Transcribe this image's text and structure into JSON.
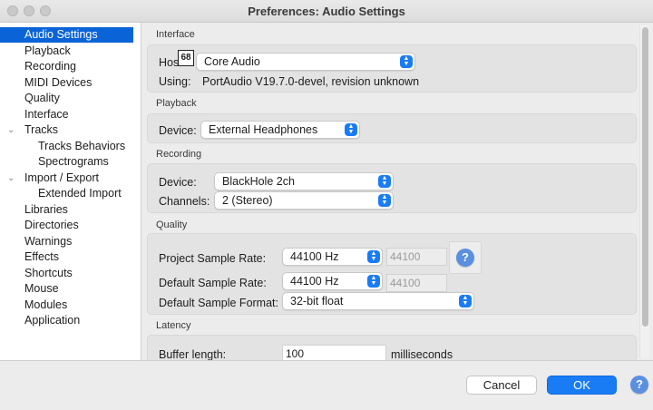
{
  "window": {
    "title": "Preferences: Audio Settings"
  },
  "sidebar": {
    "items": [
      {
        "label": "Audio Settings",
        "selected": true,
        "level": 1
      },
      {
        "label": "Playback",
        "level": 1
      },
      {
        "label": "Recording",
        "level": 1
      },
      {
        "label": "MIDI Devices",
        "level": 1
      },
      {
        "label": "Quality",
        "level": 1
      },
      {
        "label": "Interface",
        "level": 1
      },
      {
        "label": "Tracks",
        "level": 1,
        "expanded": true
      },
      {
        "label": "Tracks Behaviors",
        "level": 2
      },
      {
        "label": "Spectrograms",
        "level": 2
      },
      {
        "label": "Import / Export",
        "level": 1,
        "expanded": true
      },
      {
        "label": "Extended Import",
        "level": 2
      },
      {
        "label": "Libraries",
        "level": 1
      },
      {
        "label": "Directories",
        "level": 1
      },
      {
        "label": "Warnings",
        "level": 1
      },
      {
        "label": "Effects",
        "level": 1
      },
      {
        "label": "Shortcuts",
        "level": 1
      },
      {
        "label": "Mouse",
        "level": 1
      },
      {
        "label": "Modules",
        "level": 1
      },
      {
        "label": "Application",
        "level": 1
      }
    ]
  },
  "interface": {
    "section": "Interface",
    "host_label": "Hos",
    "host_value": "Core Audio",
    "badge": "68",
    "using_label": "Using:",
    "using_value": "PortAudio V19.7.0-devel, revision unknown"
  },
  "playback": {
    "section": "Playback",
    "device_label": "Device:",
    "device_value": "External Headphones"
  },
  "recording": {
    "section": "Recording",
    "device_label": "Device:",
    "device_value": "BlackHole 2ch",
    "channels_label": "Channels:",
    "channels_value": "2 (Stereo)"
  },
  "quality": {
    "section": "Quality",
    "project_rate_label": "Project Sample Rate:",
    "project_rate_value": "44100 Hz",
    "project_rate_field": "44100",
    "default_rate_label": "Default Sample Rate:",
    "default_rate_value": "44100 Hz",
    "default_rate_field": "44100",
    "default_format_label": "Default Sample Format:",
    "default_format_value": "32-bit float",
    "help": "?"
  },
  "latency": {
    "section": "Latency",
    "buffer_label": "Buffer length:",
    "buffer_value": "100",
    "buffer_unit": "milliseconds"
  },
  "footer": {
    "cancel_label": "Cancel",
    "ok_label": "OK",
    "help": "?"
  },
  "colors": {
    "accent": "#1a7cf5",
    "selection": "#0a64d8",
    "help": "#5b8fe0"
  }
}
